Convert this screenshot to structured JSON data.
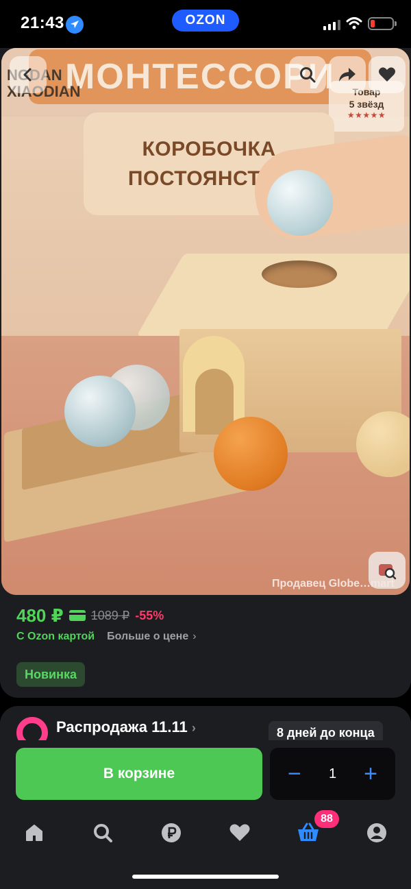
{
  "status_bar": {
    "time": "21:43",
    "brand_badge": "OZON",
    "icons": [
      "location-arrow-icon",
      "signal-icon",
      "wifi-icon",
      "battery-icon"
    ],
    "battery_color": "#ff3b30"
  },
  "product": {
    "photo": {
      "brand_logo_line1": "NGDAN",
      "brand_logo_line2": "XIAODIAN",
      "title_banner": "МОНТЕССОРИ",
      "subtitle_line1": "КОРОБОЧКА",
      "subtitle_line2": "ПОСТОЯНСТВА",
      "rating_line1": "Товар",
      "rating_line2": "5 звёзд",
      "rating_stars": "★★★★★",
      "watermark": "Продавец Globe…mart",
      "buttons": [
        "back-icon",
        "search-icon",
        "share-icon",
        "heart-icon",
        "visual-search-icon"
      ]
    },
    "price": "480 ₽",
    "old_price": "1089 ₽",
    "discount": "-55%",
    "ozon_card_label": "С Ozon картой",
    "more_price_label": "Больше о цене",
    "badge": "Новинка",
    "colors": {
      "price_green": "#52d35a",
      "discount_pink": "#ff3b6b",
      "cart_button_green": "#4dc854",
      "accent_blue": "#3b8bff"
    }
  },
  "sale": {
    "title": "Распродажа 11.11",
    "timer": "8 дней до конца"
  },
  "cart": {
    "button_label": "В корзине",
    "quantity": "1",
    "minus": "−",
    "plus": "+"
  },
  "tab_bar": {
    "tabs": [
      "home-icon",
      "search-icon",
      "ruble-icon",
      "heart-icon",
      "cart-icon",
      "profile-icon"
    ],
    "cart_count": "88"
  }
}
